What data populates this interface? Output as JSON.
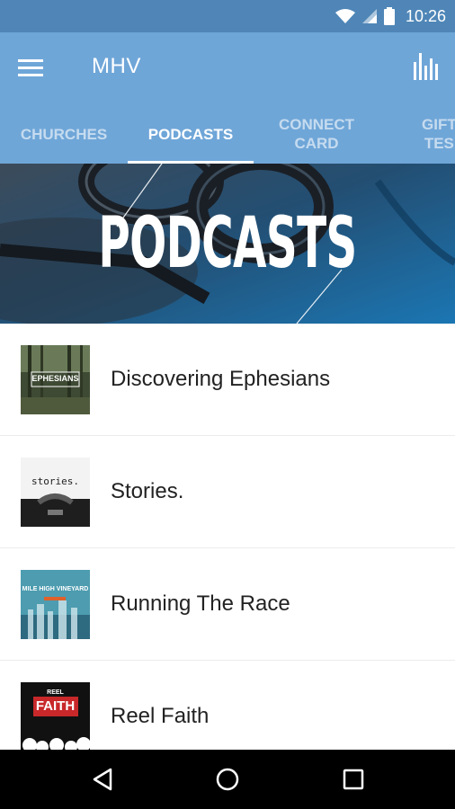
{
  "status_bar": {
    "time": "10:26",
    "icons": [
      "wifi-icon",
      "cell-signal-icon",
      "battery-icon"
    ]
  },
  "app_bar": {
    "title": "MHV",
    "menu_icon": "hamburger-menu-icon",
    "action_icon": "bar-chart-icon"
  },
  "tabs": [
    {
      "label": "CHURCHES",
      "active": false
    },
    {
      "label": "PODCASTS",
      "active": true
    },
    {
      "label": "CONNECT\nCARD",
      "active": false
    },
    {
      "label": "GIFT\nTES",
      "active": false
    }
  ],
  "hero": {
    "title": "PODCASTS"
  },
  "podcasts": [
    {
      "title": "Discovering Ephesians",
      "art_text": "EPHESIANS"
    },
    {
      "title": "Stories.",
      "art_text": "stories."
    },
    {
      "title": "Running The Race",
      "art_text": "MILE HIGH VINEYARD"
    },
    {
      "title": "Reel Faith",
      "art_text": "FAITH",
      "art_subtext": "REEL"
    }
  ],
  "colors": {
    "status_bar": "#4f86b7",
    "app_bar": "#6fa6d8",
    "hero": "#1f5f8e",
    "nav_bar": "#000000"
  },
  "nav_bar": {
    "icons": [
      "back-icon",
      "home-icon",
      "recents-icon"
    ]
  }
}
